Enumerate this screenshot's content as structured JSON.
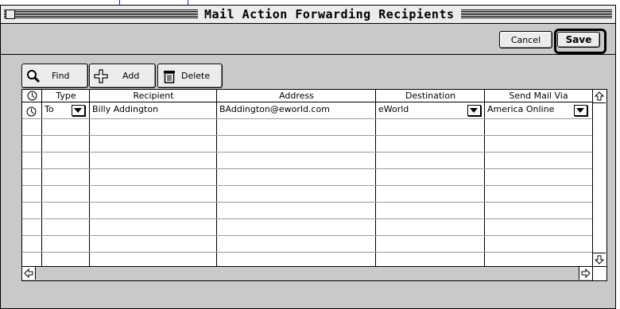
{
  "window": {
    "title": "Mail Action Forwarding Recipients"
  },
  "toolbar": {
    "cancel_label": "Cancel",
    "save_label": "Save",
    "find_label": "Find",
    "add_label": "Add",
    "delete_label": "Delete"
  },
  "table": {
    "columns": [
      "",
      "Type",
      "Recipient",
      "Address",
      "Destination",
      "Send Mail Via"
    ],
    "rows": [
      {
        "type": "To",
        "recipient": "Billy Addington",
        "address": "BAddington@eworld.com",
        "destination": "eWorld",
        "send_via": "America Online"
      }
    ]
  },
  "icons": {
    "clock": "clock-icon",
    "find": "magnifier-icon",
    "add": "plus-icon",
    "delete": "trash-icon",
    "dropdown": "dropdown-arrow-icon",
    "scroll_up": "up-arrow-icon",
    "scroll_down": "down-arrow-icon",
    "scroll_left": "left-arrow-icon",
    "scroll_right": "right-arrow-icon"
  },
  "colors": {
    "callout": "#1a2a8a",
    "window_bg": "#c9c9c9",
    "button_bg": "#ececec"
  }
}
